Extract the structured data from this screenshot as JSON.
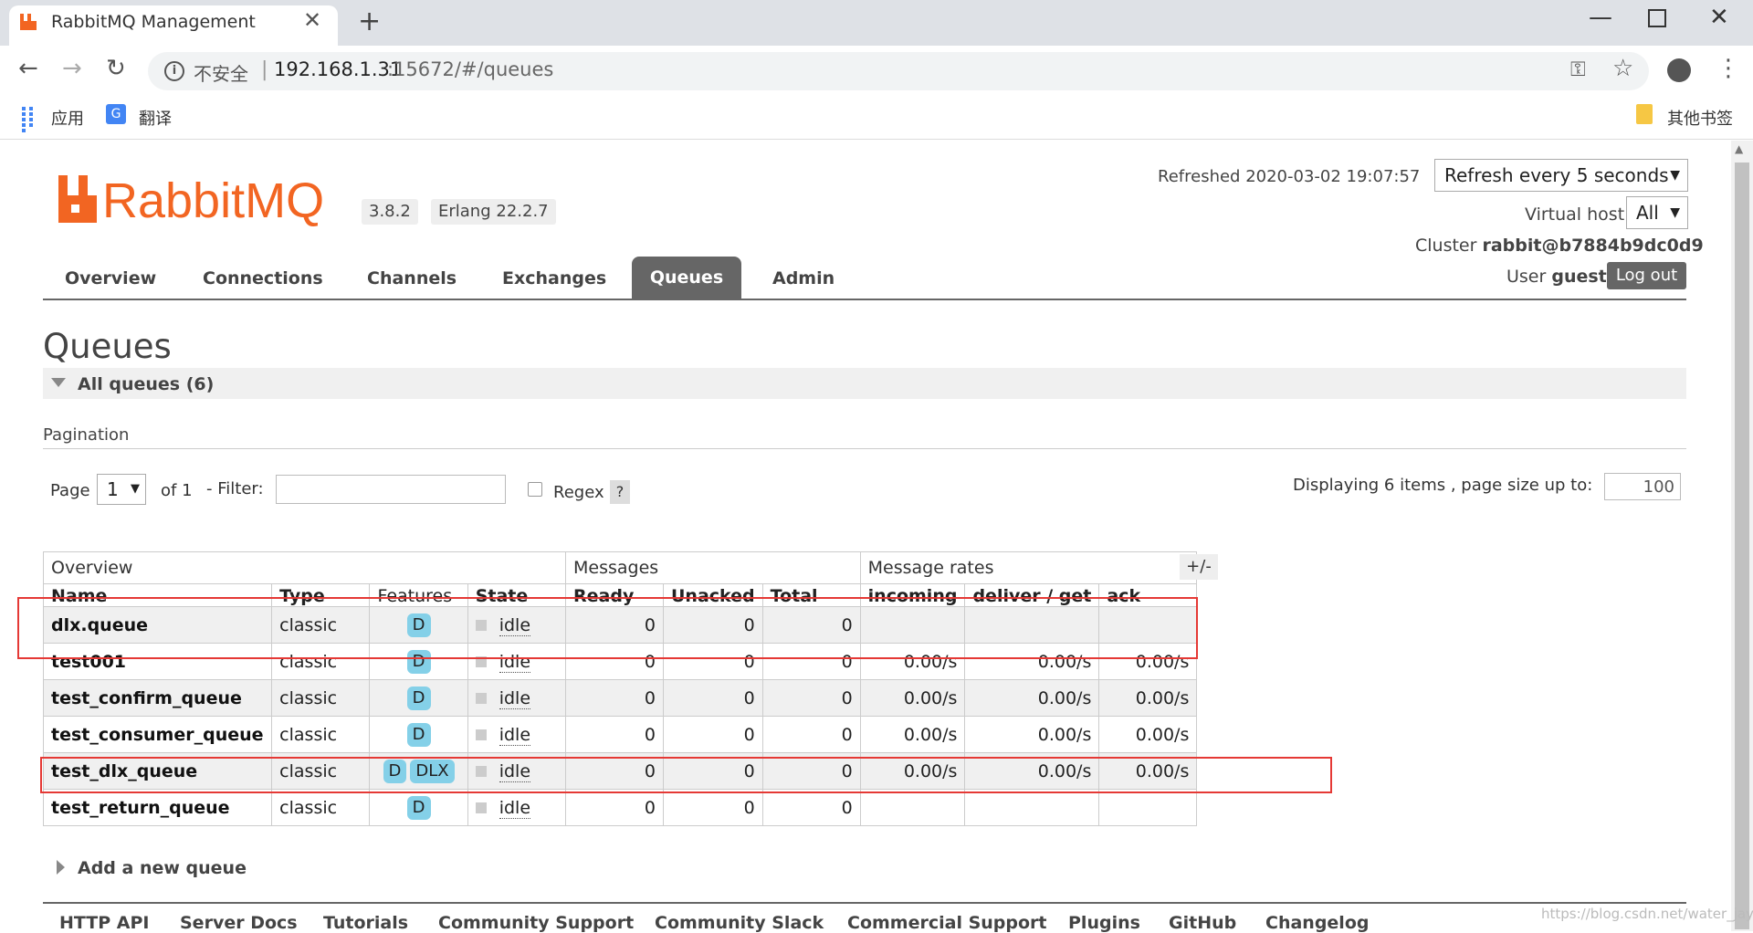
{
  "browser": {
    "tab_title": "RabbitMQ Management",
    "insecure_label": "不安全",
    "url_host": "192.168.1.31",
    "url_rest": ":15672/#/queues",
    "bookmarks": {
      "apps": "应用",
      "translate": "翻译",
      "other": "其他书签"
    }
  },
  "header": {
    "version": "3.8.2",
    "erlang": "Erlang 22.2.7",
    "refreshed": "Refreshed 2020-03-02 19:07:57",
    "refresh_select": "Refresh every 5 seconds",
    "vhost_label": "Virtual host",
    "vhost_value": "All",
    "cluster_label": "Cluster ",
    "cluster_value": "rabbit@b7884b9dc0d9",
    "user_label": "User ",
    "user_value": "guest",
    "logout": "Log out"
  },
  "nav": {
    "overview": "Overview",
    "connections": "Connections",
    "channels": "Channels",
    "exchanges": "Exchanges",
    "queues": "Queues",
    "admin": "Admin"
  },
  "page": {
    "title": "Queues",
    "section": "All queues (6)",
    "pagination_label": "Pagination",
    "page_label": "Page",
    "page_value": "1",
    "of_label": "of 1",
    "filter_label": "- Filter:",
    "regex_label": "Regex",
    "help": "?",
    "displaying": "Displaying 6 items , page size up to:",
    "page_size": "100",
    "add_queue": "Add a new queue"
  },
  "table": {
    "groups": [
      "Overview",
      "Messages",
      "Message rates"
    ],
    "plusminus": "+/-",
    "columns": [
      "Name",
      "Type",
      "Features",
      "State",
      "Ready",
      "Unacked",
      "Total",
      "incoming",
      "deliver / get",
      "ack"
    ],
    "rows": [
      {
        "name": "dlx.queue",
        "type": "classic",
        "features": [
          "D"
        ],
        "state": "idle",
        "ready": "0",
        "unacked": "0",
        "total": "0",
        "incoming": "",
        "deliver": "",
        "ack": ""
      },
      {
        "name": "test001",
        "type": "classic",
        "features": [
          "D"
        ],
        "state": "idle",
        "ready": "0",
        "unacked": "0",
        "total": "0",
        "incoming": "0.00/s",
        "deliver": "0.00/s",
        "ack": "0.00/s"
      },
      {
        "name": "test_confirm_queue",
        "type": "classic",
        "features": [
          "D"
        ],
        "state": "idle",
        "ready": "0",
        "unacked": "0",
        "total": "0",
        "incoming": "0.00/s",
        "deliver": "0.00/s",
        "ack": "0.00/s"
      },
      {
        "name": "test_consumer_queue",
        "type": "classic",
        "features": [
          "D"
        ],
        "state": "idle",
        "ready": "0",
        "unacked": "0",
        "total": "0",
        "incoming": "0.00/s",
        "deliver": "0.00/s",
        "ack": "0.00/s"
      },
      {
        "name": "test_dlx_queue",
        "type": "classic",
        "features": [
          "D",
          "DLX"
        ],
        "state": "idle",
        "ready": "0",
        "unacked": "0",
        "total": "0",
        "incoming": "0.00/s",
        "deliver": "0.00/s",
        "ack": "0.00/s"
      },
      {
        "name": "test_return_queue",
        "type": "classic",
        "features": [
          "D"
        ],
        "state": "idle",
        "ready": "0",
        "unacked": "0",
        "total": "0",
        "incoming": "",
        "deliver": "",
        "ack": ""
      }
    ]
  },
  "footer": [
    "HTTP API",
    "Server Docs",
    "Tutorials",
    "Community Support",
    "Community Slack",
    "Commercial Support",
    "Plugins",
    "GitHub",
    "Changelog"
  ],
  "watermark": "https://blog.csdn.net/water_jay",
  "colors": {
    "rabbit_orange": "#f26522",
    "highlight_red": "#e53935",
    "feature_badge": "#84d0e8",
    "nav_active": "#666666"
  }
}
